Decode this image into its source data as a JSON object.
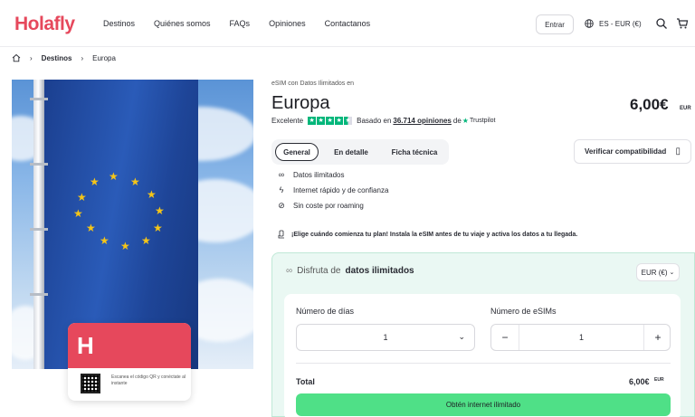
{
  "header": {
    "logo": "Holafly",
    "nav": [
      "Destinos",
      "Quiénes somos",
      "FAQs",
      "Opiniones",
      "Contactanos"
    ],
    "login_label": "Entrar",
    "locale": "ES - EUR (€)"
  },
  "breadcrumb": {
    "items": [
      "Destinos",
      "Europa"
    ]
  },
  "hero": {
    "card_text": "Escanea el código QR y conéctate al instante"
  },
  "product": {
    "subtitle": "eSIM con Datos Ilimitados en",
    "title": "Europa",
    "price": "6,00€",
    "price_currency": "EUR",
    "rating_word": "Excelente",
    "rating_stars": 4.5,
    "reviews_prefix": "Basado en",
    "reviews_count": "36.714 opiniones",
    "reviews_suffix": "de",
    "trustpilot": "Trustpilot"
  },
  "tabs": [
    {
      "label": "General",
      "active": true
    },
    {
      "label": "En detalle",
      "active": false
    },
    {
      "label": "Ficha técnica",
      "active": false
    }
  ],
  "verify_label": "Verificar compatibilidad",
  "features": [
    {
      "icon": "infinity-icon",
      "label": "Datos ilimitados"
    },
    {
      "icon": "lightning-icon",
      "label": "Internet rápido y de confianza"
    },
    {
      "icon": "no-phone-icon",
      "label": "Sin coste por roaming"
    }
  ],
  "tip": "¡Elige cuándo comienza tu plan! Instala la eSIM antes de tu viaje y activa los datos a tu llegada.",
  "config": {
    "title_prefix": "Disfruta de",
    "title_bold": "datos ilimitados",
    "currency_select": "EUR (€)",
    "days_label": "Número de días",
    "days_value": "1",
    "esims_label": "Número de eSIMs",
    "esims_value": "1",
    "total_label": "Total",
    "total_value": "6,00€",
    "total_currency": "EUR",
    "cta_label": "Obtén internet ilimitado"
  },
  "colors": {
    "brand": "#e6485c",
    "trustpilot_green": "#00b67a",
    "cta_green": "#4fe087",
    "panel_bg": "#eaf8f3"
  }
}
